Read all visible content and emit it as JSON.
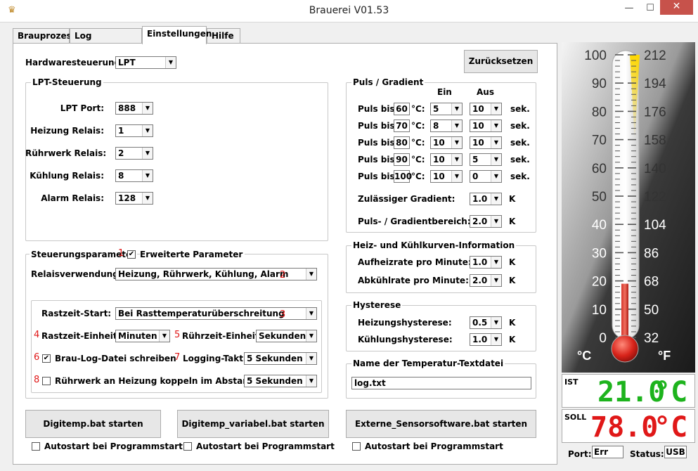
{
  "window": {
    "title": "Brauerei V01.53",
    "minimize": "—",
    "maximize": "☐",
    "close": "✕",
    "icon": "app-icon"
  },
  "tabs": [
    "Brauprozess",
    "Log Auswertung",
    "Einstellungen",
    "Hilfe"
  ],
  "hardware": {
    "label": "Hardwaresteuerung:",
    "value": "LPT"
  },
  "reset_button": "Zurücksetzen",
  "lpt": {
    "title": "LPT-Steuerung",
    "port_label": "LPT Port:",
    "port_value": "888",
    "heizung_label": "Heizung Relais:",
    "heizung_value": "1",
    "ruehrwerk_label": "Rührwerk Relais:",
    "ruehrwerk_value": "2",
    "kuehlung_label": "Kühlung Relais:",
    "kuehlung_value": "8",
    "alarm_label": "Alarm Relais:",
    "alarm_value": "128"
  },
  "params": {
    "title": "Steuerungsparameter",
    "ext_label": "Erweiterte Parameter",
    "ext_checked": true,
    "relais_label": "Relaisverwendung:",
    "relais_value": "Heizung, Rührwerk, Kühlung, Alarm",
    "rast_start_label": "Rastzeit-Start:",
    "rast_start_value": "Bei Rasttemperaturüberschreitung",
    "rast_unit_label": "Rastzeit-Einheit:",
    "rast_unit_value": "Minuten",
    "ruehr_unit_label": "Rührzeit-Einheit:",
    "ruehr_unit_value": "Sekunden",
    "log_label": "Brau-Log-Datei schreiben",
    "log_checked": true,
    "log_takt_label": "Logging-Takt:",
    "log_takt_value": "5 Sekunden",
    "couple_label": "Rührwerk an Heizung koppeln im Abstand von",
    "couple_checked": false,
    "couple_value": "5 Sekunden"
  },
  "markers": [
    "1",
    "2",
    "3",
    "4",
    "5",
    "6",
    "7",
    "8"
  ],
  "puls": {
    "title": "Puls / Gradient",
    "col_ein": "Ein",
    "col_aus": "Aus",
    "row_label": "Puls bis",
    "unit_c": "°C:",
    "unit_s": "sek.",
    "rows": [
      {
        "temp": "60",
        "ein": "5",
        "aus": "10"
      },
      {
        "temp": "70",
        "ein": "8",
        "aus": "10"
      },
      {
        "temp": "80",
        "ein": "10",
        "aus": "10"
      },
      {
        "temp": "90",
        "ein": "10",
        "aus": "5"
      },
      {
        "temp": "100",
        "ein": "10",
        "aus": "0"
      }
    ],
    "grad_label": "Zulässiger Gradient:",
    "grad_value": "1.0",
    "grad_unit": "K",
    "bereich_label": "Puls- / Gradientbereich:",
    "bereich_value": "2.0",
    "bereich_unit": "K"
  },
  "kurven": {
    "title": "Heiz- und Kühlkurven-Information",
    "auf_label": "Aufheizrate pro Minute:",
    "auf_value": "1.0",
    "ab_label": "Abkühlrate pro Minute:",
    "ab_value": "2.0",
    "unit": "K"
  },
  "hysterese": {
    "title": "Hysterese",
    "heiz_label": "Heizungshysterese:",
    "heiz_value": "0.5",
    "kuehl_label": "Kühlungshysterese:",
    "kuehl_value": "1.0",
    "unit": "K"
  },
  "textdatei": {
    "title": "Name der Temperatur-Textdatei",
    "value": "log.txt"
  },
  "buttons": {
    "digitemp": "Digitemp.bat starten",
    "digitemp_var": "Digitemp_variabel.bat starten",
    "extern": "Externe_Sensorsoftware.bat starten",
    "autostart": "Autostart bei Programmstart"
  },
  "thermo": {
    "c_ticks": [
      "100",
      "90",
      "80",
      "70",
      "60",
      "50",
      "40",
      "30",
      "20",
      "10",
      "0"
    ],
    "f_ticks": [
      "212",
      "194",
      "176",
      "158",
      "140",
      "122",
      "104",
      "86",
      "68",
      "50",
      "32"
    ],
    "c_unit": "°C",
    "f_unit": "°F",
    "level_c": 19
  },
  "ist": {
    "label": "IST",
    "value": "21.0",
    "unit": "°C",
    "color": "#1db31d"
  },
  "soll": {
    "label": "SOLL",
    "value": "78.0",
    "unit": "°C",
    "color": "#e01818"
  },
  "status": {
    "port_label": "Port:",
    "port_value": "Err",
    "status_label": "Status:",
    "status_value": "USB"
  }
}
